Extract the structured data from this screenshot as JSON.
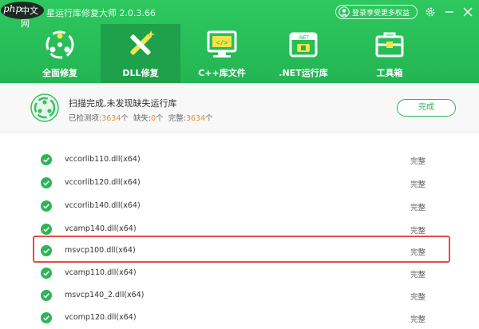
{
  "app": {
    "logo_latin": "php",
    "logo_cn": "中文网",
    "title": "星运行库修复大师 2.0.3.66",
    "login": "登录享受更多权益"
  },
  "nav": [
    {
      "label": "全面修复",
      "icon": "full-repair-icon",
      "active": false
    },
    {
      "label": "DLL修复",
      "icon": "dll-repair-icon",
      "active": true
    },
    {
      "label": "C++库文件",
      "icon": "cpp-library-icon",
      "active": false
    },
    {
      "label": ".NET运行库",
      "icon": "dotnet-runtime-icon",
      "active": false
    },
    {
      "label": "工具箱",
      "icon": "toolbox-icon",
      "active": false
    }
  ],
  "status": {
    "message": "扫描完成,未发现缺失运行库",
    "detected_label": "已检测项:",
    "detected_count": "3634",
    "missing_label": "缺失:",
    "missing_count": "0",
    "complete_label": "完整:",
    "complete_count": "3634",
    "unit": "个",
    "done_button": "完成"
  },
  "colors": {
    "brand_green": "#23b553",
    "active_tab": "#1ea14a",
    "count_orange": "#f08a24",
    "highlight_red": "#e54b4b"
  },
  "rows": [
    {
      "name": "vccorlib110.dll(x64)",
      "state": "完整"
    },
    {
      "name": "vccorlib120.dll(x64)",
      "state": "完整"
    },
    {
      "name": "vccorlib140.dll(x64)",
      "state": "完整"
    },
    {
      "name": "vcamp140.dll(x64)",
      "state": "完整"
    },
    {
      "name": "msvcp100.dll(x64)",
      "state": "完整"
    },
    {
      "name": "vcamp110.dll(x64)",
      "state": "完整"
    },
    {
      "name": "msvcp140_2.dll(x64)",
      "state": "完整"
    },
    {
      "name": "vcomp120.dll(x64)",
      "state": "完整"
    }
  ]
}
